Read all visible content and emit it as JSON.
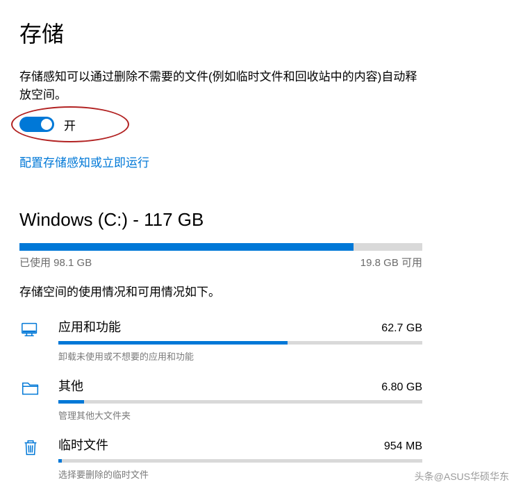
{
  "pageTitle": "存储",
  "description": "存储感知可以通过删除不需要的文件(例如临时文件和回收站中的内容)自动释放空间。",
  "toggle": {
    "label": "开",
    "on": true
  },
  "configLink": "配置存储感知或立即运行",
  "drive": {
    "title": "Windows (C:) - 117 GB",
    "usedLabel": "已使用 98.1 GB",
    "freeLabel": "19.8 GB 可用",
    "usedPercent": 83
  },
  "usageDesc": "存储空间的使用情况和可用情况如下。",
  "categories": [
    {
      "name": "应用和功能",
      "size": "62.7 GB",
      "percent": 63,
      "sub": "卸载未使用或不想要的应用和功能",
      "icon": "apps"
    },
    {
      "name": "其他",
      "size": "6.80 GB",
      "percent": 7,
      "sub": "管理其他大文件夹",
      "icon": "folder"
    },
    {
      "name": "临时文件",
      "size": "954 MB",
      "percent": 1,
      "sub": "选择要删除的临时文件",
      "icon": "trash"
    }
  ],
  "watermark": "头条@ASUS华硕华东"
}
